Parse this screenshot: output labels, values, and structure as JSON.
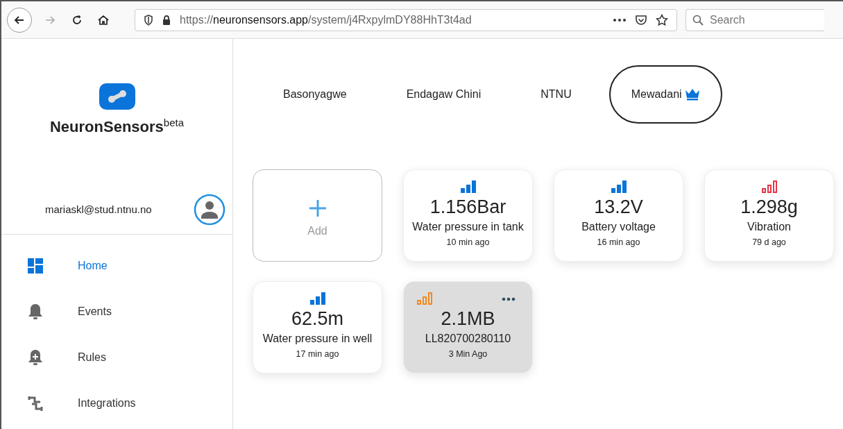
{
  "browser": {
    "url_host": "neuronsensors.app",
    "url_prefix": "https://",
    "url_path": "/system/j4RxpylmDY88HhT3t4ad",
    "search": {
      "placeholder": "Search"
    }
  },
  "sidebar": {
    "brand": "NeuronSensors",
    "brand_sup": "beta",
    "user_email": "mariaskl@stud.ntnu.no",
    "items": [
      {
        "label": "Home",
        "kind": "home",
        "selected": true
      },
      {
        "label": "Events",
        "kind": "events",
        "selected": false
      },
      {
        "label": "Rules",
        "kind": "rules",
        "selected": false
      },
      {
        "label": "Integrations",
        "kind": "integrations",
        "selected": false
      }
    ]
  },
  "tabs": [
    {
      "label": "Basonyagwe",
      "selected": false,
      "owner": false
    },
    {
      "label": "Endagaw Chini",
      "selected": false,
      "owner": false
    },
    {
      "label": "NTNU",
      "selected": false,
      "owner": false
    },
    {
      "label": "Mewadani",
      "selected": true,
      "owner": true
    }
  ],
  "cards": [
    {
      "kind": "add",
      "label": "Add"
    },
    {
      "kind": "sensor",
      "value": "1.156Bar",
      "name": "Water pressure in tank",
      "time": "10 min ago",
      "color": "#0a74da",
      "signal_filled": true,
      "selected": false
    },
    {
      "kind": "sensor",
      "value": "13.2V",
      "name": "Battery voltage",
      "time": "16 min ago",
      "color": "#0a74da",
      "signal_filled": true,
      "selected": false
    },
    {
      "kind": "sensor",
      "value": "1.298g",
      "name": "Vibration",
      "time": "79 d ago",
      "color": "#e8344a",
      "signal_filled": false,
      "selected": false
    },
    {
      "kind": "sensor",
      "value": "62.5m",
      "name": "Water pressure in well",
      "time": "17 min ago",
      "color": "#0a74da",
      "signal_filled": true,
      "selected": false
    },
    {
      "kind": "sensor",
      "value": "2.1MB",
      "name": "LL820700280110",
      "time": "3 Min Ago",
      "color": "#f08a1c",
      "signal_filled": false,
      "selected": true
    }
  ]
}
